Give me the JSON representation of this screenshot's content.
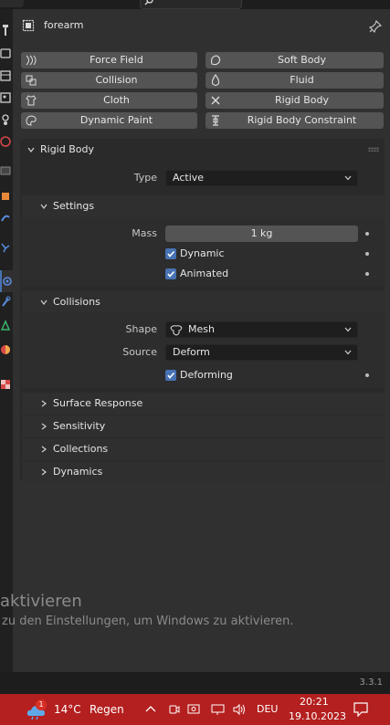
{
  "object": {
    "name": "forearm"
  },
  "physics_buttons": [
    {
      "label": "Force Field",
      "icon": "force-field-icon"
    },
    {
      "label": "Soft Body",
      "icon": "soft-body-icon"
    },
    {
      "label": "Collision",
      "icon": "collision-icon"
    },
    {
      "label": "Fluid",
      "icon": "fluid-icon"
    },
    {
      "label": "Cloth",
      "icon": "cloth-icon"
    },
    {
      "label": "Rigid Body",
      "icon": "rigid-body-x-icon"
    },
    {
      "label": "Dynamic Paint",
      "icon": "dynamic-paint-icon"
    },
    {
      "label": "Rigid Body Constraint",
      "icon": "rigid-body-constraint-icon"
    }
  ],
  "rigid_body": {
    "title": "Rigid Body",
    "type_label": "Type",
    "type_value": "Active",
    "settings": {
      "title": "Settings",
      "mass_label": "Mass",
      "mass_value": "1 kg",
      "dynamic_label": "Dynamic",
      "dynamic_checked": true,
      "animated_label": "Animated",
      "animated_checked": true
    },
    "collisions": {
      "title": "Collisions",
      "shape_label": "Shape",
      "shape_value": "Mesh",
      "source_label": "Source",
      "source_value": "Deform",
      "deforming_label": "Deforming",
      "deforming_checked": true
    },
    "collapsed_panels": [
      "Surface Response",
      "Sensitivity",
      "Collections",
      "Dynamics"
    ]
  },
  "watermark": {
    "line1": "aktivieren",
    "line2": "zu den Einstellungen, um Windows zu aktivieren."
  },
  "status": {
    "version": "3.3.1"
  },
  "taskbar": {
    "weather_badge": "1",
    "temperature": "14°C",
    "weather": "Regen",
    "language": "DEU",
    "time": "20:21",
    "date": "19.10.2023"
  },
  "colors": {
    "accent": "#4772b3",
    "taskbar": "#b3201f",
    "panel": "#303030",
    "button": "#545454"
  }
}
